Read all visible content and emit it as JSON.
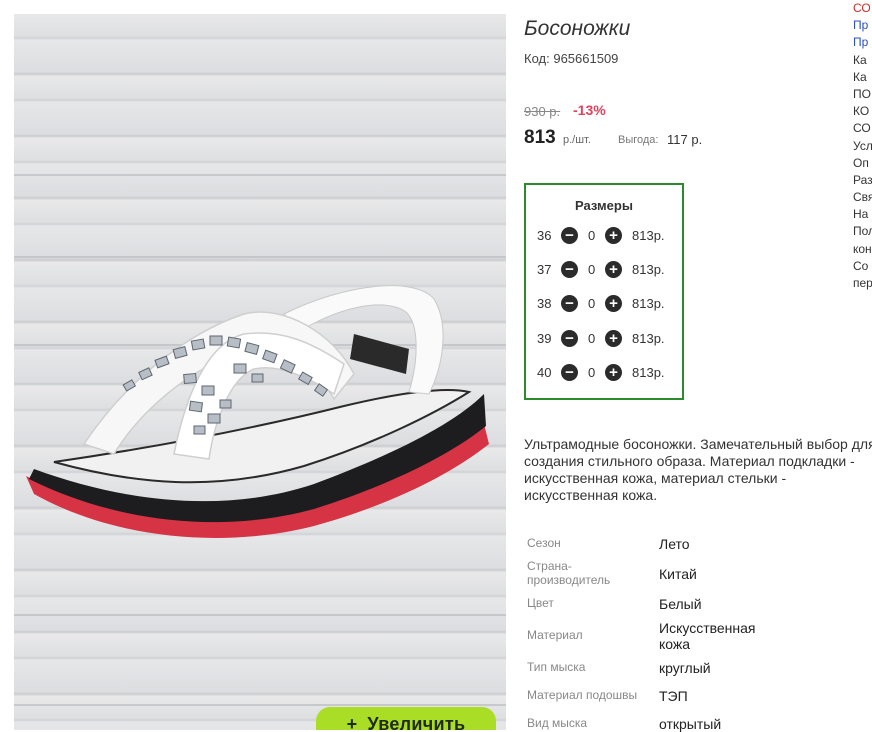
{
  "photo": {
    "zoom_button_label": "Увеличить",
    "zoom_button_icon": "plus-icon"
  },
  "product": {
    "title": "Босоножки",
    "code_label": "Код:",
    "code_value": "965661509",
    "old_price": "930 р.",
    "discount": "-13%",
    "price": "813",
    "price_unit": "р./шт.",
    "profit_label": "Выгода:",
    "profit_value": "117 р."
  },
  "sizes": {
    "heading": "Размеры",
    "rows": [
      {
        "size": "36",
        "qty": "0",
        "price": "813р."
      },
      {
        "size": "37",
        "qty": "0",
        "price": "813р."
      },
      {
        "size": "38",
        "qty": "0",
        "price": "813р."
      },
      {
        "size": "39",
        "qty": "0",
        "price": "813р."
      },
      {
        "size": "40",
        "qty": "0",
        "price": "813р."
      }
    ]
  },
  "description": "Ультрамодные босоножки. Замечательный выбор для создания стильного образа. Материал подкладки - искусственная кожа, материал стельки - искусственная кожа.",
  "specs": [
    {
      "key": "Сезон",
      "value": "Лето"
    },
    {
      "key": "Страна-производитель",
      "value": "Китай"
    },
    {
      "key": "Цвет",
      "value": "Белый"
    },
    {
      "key": "Материал",
      "value": "Искусственная кожа"
    },
    {
      "key": "Тип мыска",
      "value": "круглый"
    },
    {
      "key": "Материал подошвы",
      "value": "ТЭП"
    },
    {
      "key": "Вид мыска",
      "value": "открытый"
    }
  ],
  "sidebar": {
    "links": [
      {
        "text": "СО",
        "color": "#d52a2a"
      },
      {
        "text": "Пр",
        "color": "#2a4fbf"
      },
      {
        "text": "Пр",
        "color": "#2a4fbf"
      },
      {
        "text": "Ка",
        "color": "#333333"
      },
      {
        "text": "Ка",
        "color": "#333333"
      },
      {
        "text": "ПО",
        "color": "#333333"
      },
      {
        "text": "КО",
        "color": "#333333"
      },
      {
        "text": "СО",
        "color": "#333333"
      },
      {
        "text": "Усл",
        "color": "#333333"
      },
      {
        "text": "Оп",
        "color": "#333333"
      },
      {
        "text": "Раз",
        "color": "#333333"
      },
      {
        "text": "Свя",
        "color": "#333333"
      },
      {
        "text": "На",
        "color": "#333333"
      },
      {
        "text": "Пол",
        "color": "#333333"
      },
      {
        "text": "кон",
        "color": "#333333"
      },
      {
        "text": "Со",
        "color": "#333333"
      },
      {
        "text": "пер",
        "color": "#333333"
      }
    ]
  },
  "colors": {
    "accent_green_border": "#2c8b2c",
    "discount_red": "#e2405b",
    "zoom_button_green": "#a9dd26"
  }
}
